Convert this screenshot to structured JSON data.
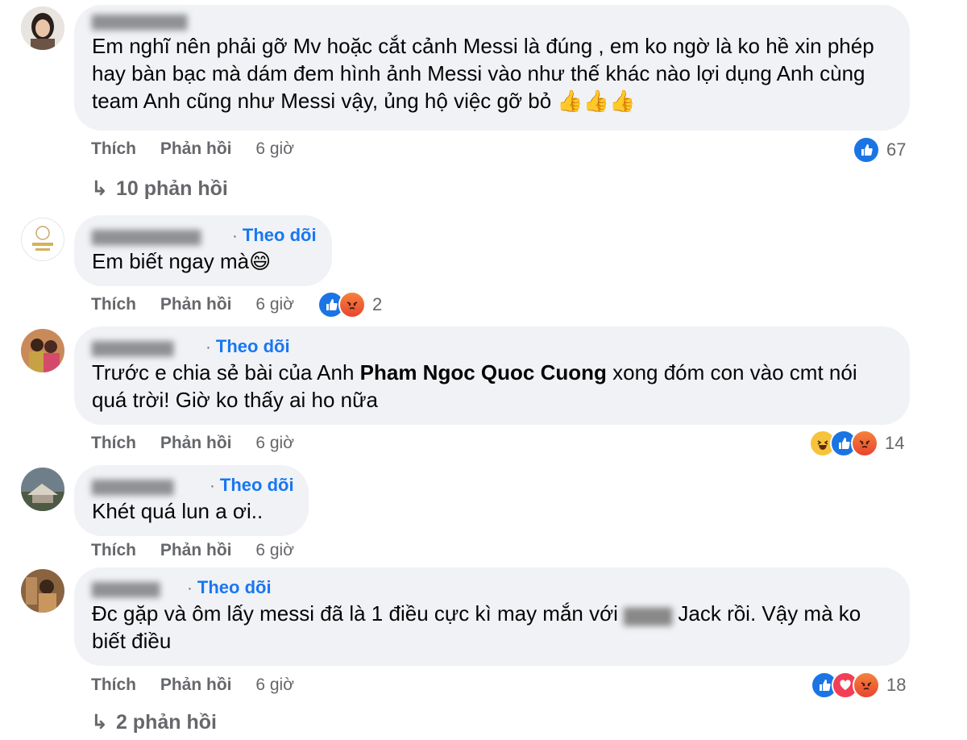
{
  "comments": [
    {
      "text": "Em nghĩ nên phải gỡ Mv hoặc cắt cảnh Messi là đúng , em ko ngờ là ko hề xin phép hay bàn bạc mà dám đem hình ảnh Messi vào như thế khác nào lợi dụng Anh cùng team Anh cũng như Messi vậy, ủng hộ việc gỡ bỏ 👍👍👍",
      "like": "Thích",
      "reply": "Phản hồi",
      "time": "6 giờ",
      "reaction_count": "67",
      "replies_label": "10 phản hồi"
    },
    {
      "follow": "Theo dõi",
      "text": "Em biết ngay mà😄",
      "like": "Thích",
      "reply": "Phản hồi",
      "time": "6 giờ",
      "reaction_count": "2"
    },
    {
      "follow": "Theo dõi",
      "text_before": "Trước e chia sẻ bài của Anh ",
      "mention": "Pham Ngoc Quoc Cuong",
      "text_after": " xong đóm con vào cmt nói quá trời! Giờ ko thấy ai ho nữa",
      "like": "Thích",
      "reply": "Phản hồi",
      "time": "6 giờ",
      "reaction_count": "14"
    },
    {
      "follow": "Theo dõi",
      "text": "Khét quá lun a ơi..",
      "like": "Thích",
      "reply": "Phản hồi",
      "time": "6 giờ"
    },
    {
      "follow": "Theo dõi",
      "text_before": "Đc gặp và ôm lấy messi đã là 1 điều cực kì may mắn với ",
      "text_after": " Jack rồi. Vậy mà ko biết điều",
      "like": "Thích",
      "reply": "Phản hồi",
      "time": "6 giờ",
      "reaction_count": "18",
      "replies_label": "2 phản hồi"
    }
  ],
  "colors": {
    "link": "#1877f2",
    "bubble": "#f0f2f5",
    "meta": "#65676b"
  }
}
